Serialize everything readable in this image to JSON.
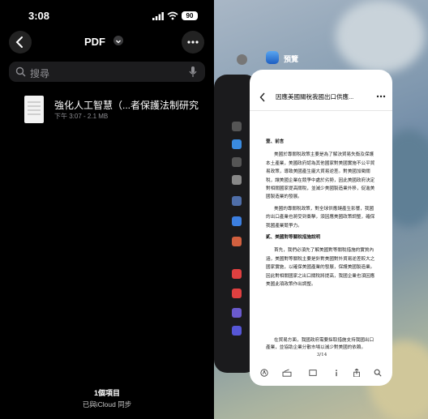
{
  "status_bar": {
    "time": "3:08",
    "battery": "90"
  },
  "files_app": {
    "folder_title": "PDF",
    "search_placeholder": "搜尋",
    "file": {
      "name": "強化人工智慧（...者保護法制研究",
      "meta": "下午 3:07 - 2.1 MB"
    },
    "footer": {
      "item_count": "1個項目",
      "sync_status": "已與iCloud 同步"
    }
  },
  "switcher": {
    "app_label": "預覽",
    "document": {
      "title": "因應美國關稅我國出口供應...",
      "section1_heading": "壹、前言",
      "para1": "美國於專關稅政策主要是為了解決貿易失衡及保護本土產業，美國政府認為其他國家對美國實施不公平貿易政策，導致美國產生龐大貿易逆差。對美國加徵關稅，讓美國企業在競爭中處於劣勢，因此美國政府決定對相關國家提高關稅，並減少美國製造業外移，促進美國製造業的發展。",
      "para2": "美國的專關稅政策，對全球供應鏈產生影響，我國的出口產業也將受到衝擊，須因應美國政策調整，確保我國產業競爭力。",
      "section2_heading": "貳、美國對等關稅措施說明",
      "para3": "首先，我們必須先了解美國對等關稅措施的實質內涵，美國對等關稅主要是針對美國對外貿易逆差較大之國家實施，以確保美國產業的發展，保護美國製造業。因此對相關國家之出口關稅將提高，我國企業也須因應美國此項政策作出調整。",
      "bottom_text": "在貿易方面，我國政府需要採取措施支持我國出口產業，並協助企業分散市場以減少對美國的依賴。",
      "page_number": "3/14"
    }
  },
  "icons": {
    "back": "chevron-left-icon",
    "more": "ellipsis-icon",
    "title_menu": "chevron-down-icon",
    "search": "magnifier-icon",
    "mic": "microphone-icon",
    "wifi": "wifi-icon",
    "signal": "cellular-signal-icon"
  }
}
